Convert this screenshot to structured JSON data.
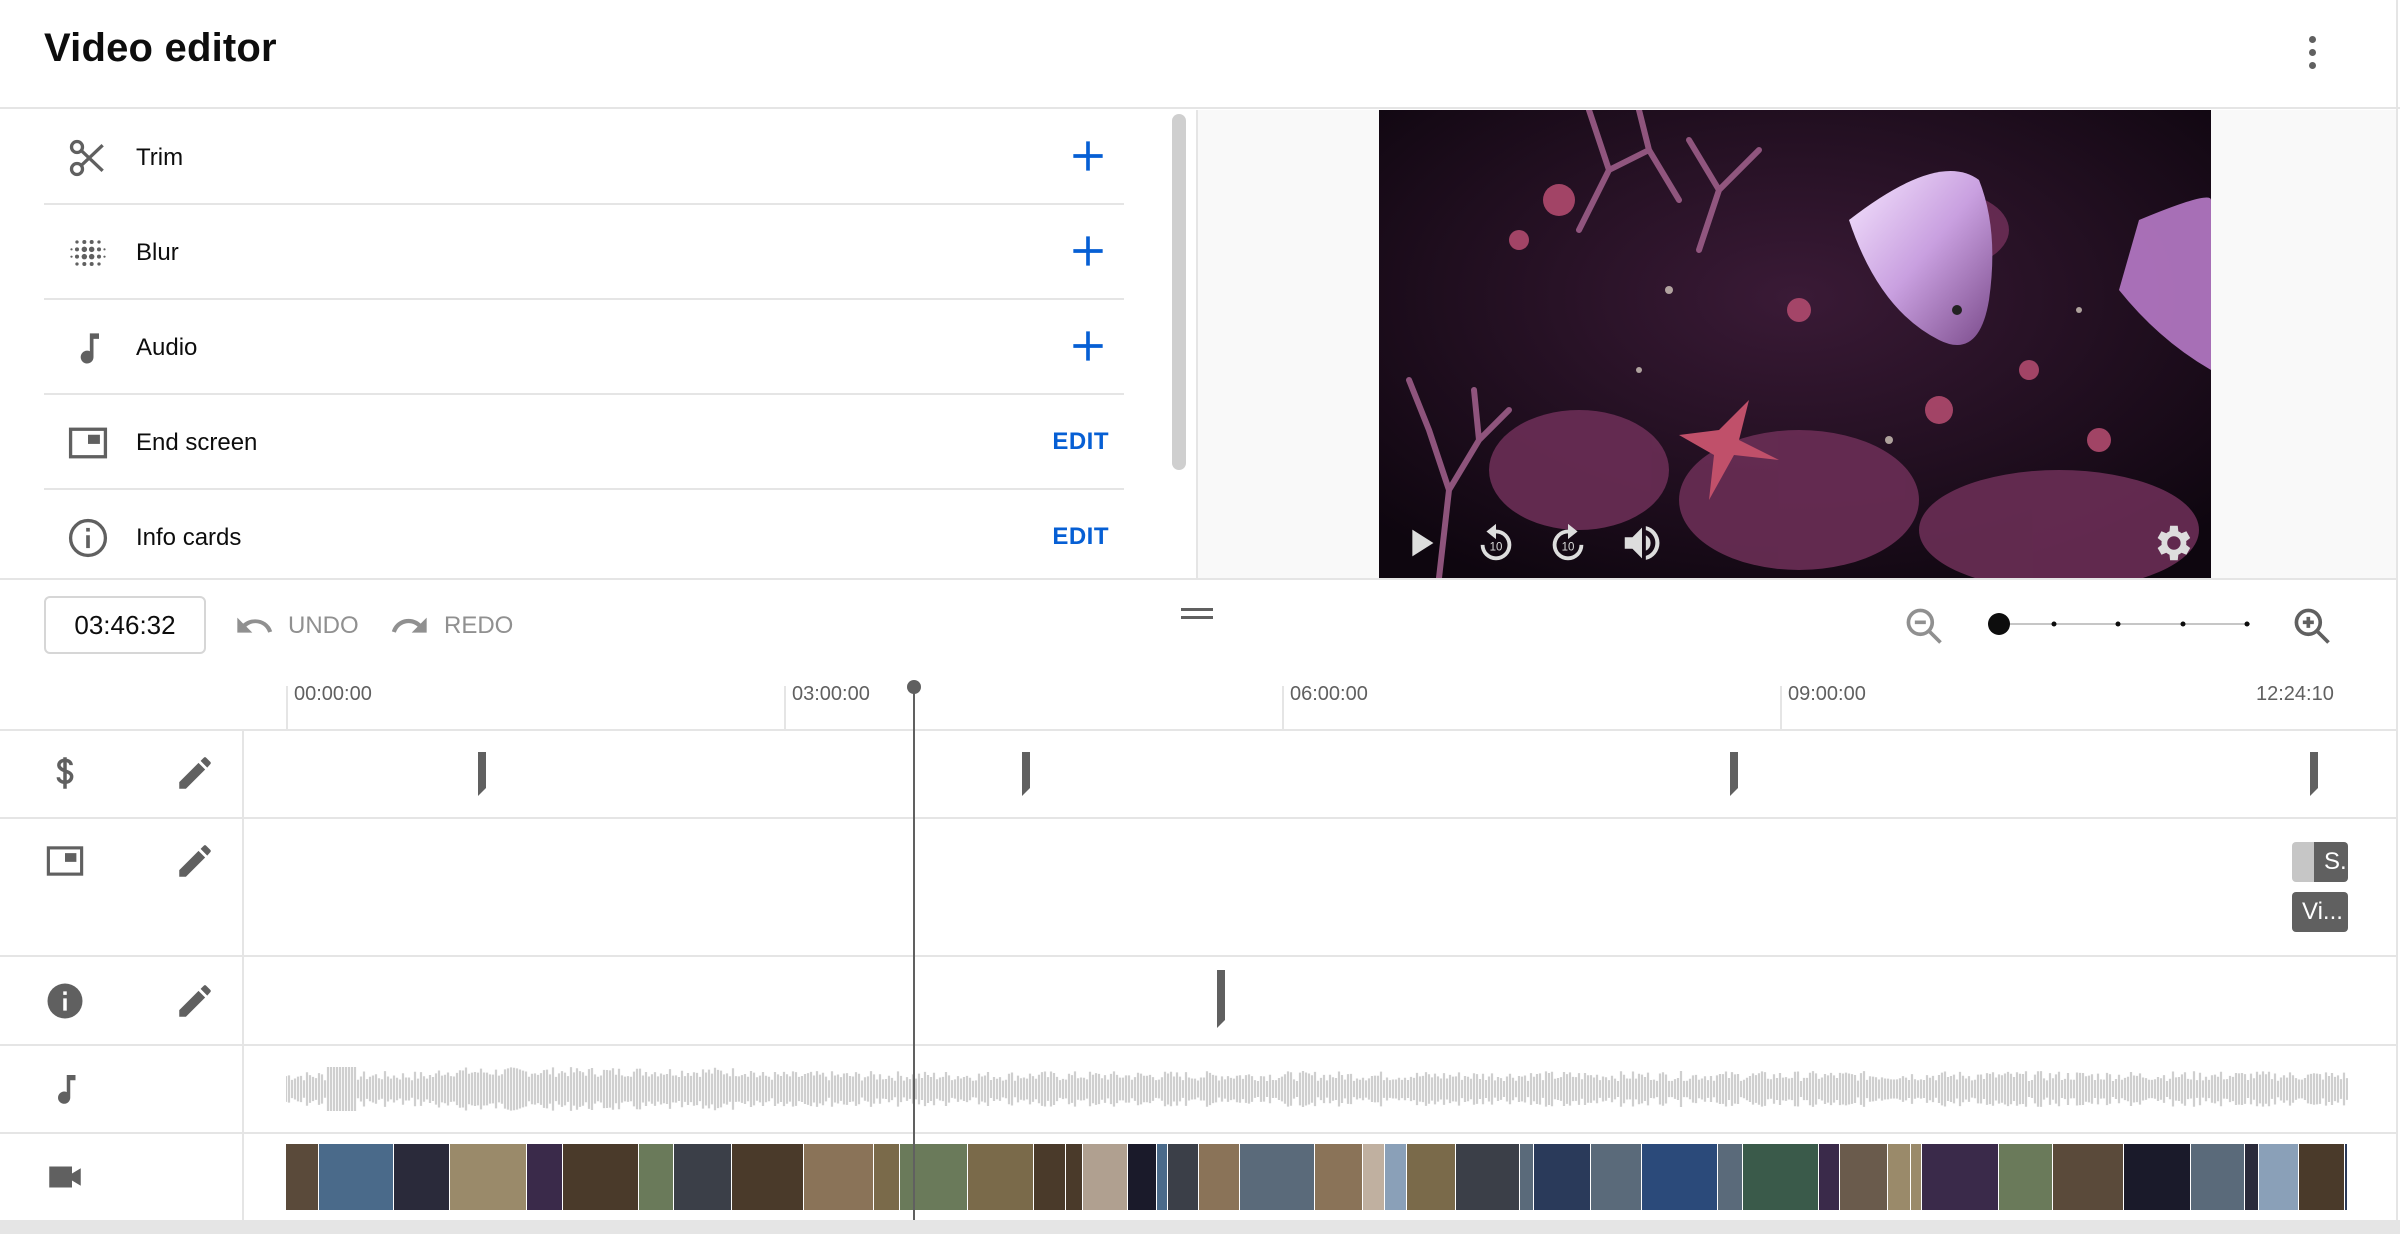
{
  "header": {
    "title": "Video editor",
    "more_icon": "more-vert-icon"
  },
  "tools": [
    {
      "label": "Trim",
      "icon": "scissors-icon",
      "action": "+",
      "action_type": "add"
    },
    {
      "label": "Blur",
      "icon": "blur-icon",
      "action": "+",
      "action_type": "add"
    },
    {
      "label": "Audio",
      "icon": "music-note-icon",
      "action": "+",
      "action_type": "add"
    },
    {
      "label": "End screen",
      "icon": "end-screen-icon",
      "action": "EDIT",
      "action_type": "edit"
    },
    {
      "label": "Info cards",
      "icon": "info-icon",
      "action": "EDIT",
      "action_type": "edit"
    }
  ],
  "toolbar": {
    "current_time": "03:46:32",
    "undo_label": "UNDO",
    "redo_label": "REDO",
    "zoom_level_fraction": 0
  },
  "timeline": {
    "ruler": [
      "00:00:00",
      "03:00:00",
      "06:00:00",
      "09:00:00",
      "12:24:10"
    ],
    "tracks": [
      {
        "name": "ad-breaks",
        "icon": "dollar-icon"
      },
      {
        "name": "end-screen",
        "icon": "end-screen-icon"
      },
      {
        "name": "info-cards",
        "icon": "info-icon"
      },
      {
        "name": "audio",
        "icon": "music-note-icon"
      },
      {
        "name": "video",
        "icon": "videocam-icon"
      }
    ],
    "end_screen_chips": [
      "S...",
      "Vi..."
    ]
  },
  "colors": {
    "accent": "#065fd4",
    "icon_grey": "#606060",
    "divider": "#e5e5e5"
  }
}
